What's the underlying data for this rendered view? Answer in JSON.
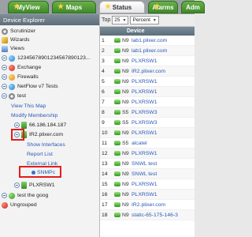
{
  "tabs": [
    {
      "label": "MyView"
    },
    {
      "label": "Maps"
    },
    {
      "label": "Status"
    },
    {
      "label": "Alarms"
    },
    {
      "label": "Adm"
    }
  ],
  "explorer": {
    "title": "Device Explorer",
    "scrutinizer": "Scrutinizer",
    "wizards": "Wizards",
    "views": "Views",
    "group_numeric": "12345678901234567890123...",
    "exchange": "Exchange",
    "firewalls": "Firewalls",
    "netflow": "NetFlow v7 Tests",
    "test": "test",
    "view_this_map": "View This Map",
    "modify_membership": "Modify Membership",
    "ip_device": "66.186.184.187",
    "ir2": "IR2.plixer.com",
    "show_interfaces": "Show Interfaces",
    "report_list": "Report List",
    "external_link": "External Link",
    "snmpc": "SNMPc",
    "plxrsw1": "PLXRSW1",
    "test_goog": "test the goog",
    "ungrouped": "Ungrouped"
  },
  "grid": {
    "top_label": "Top",
    "top_value": "25",
    "sort_value": "Percent",
    "col_device": "Device",
    "rows": [
      {
        "num": "1",
        "type": "N9",
        "device": "lab1.plixer.com"
      },
      {
        "num": "2",
        "type": "N9",
        "device": "lab1.plixer.com"
      },
      {
        "num": "3",
        "type": "N9",
        "device": "PLXRSW1"
      },
      {
        "num": "4",
        "type": "N9",
        "device": "IR2.plixer.com"
      },
      {
        "num": "5",
        "type": "N9",
        "device": "PLXRSW1"
      },
      {
        "num": "6",
        "type": "N9",
        "device": "PLXRSW1"
      },
      {
        "num": "7",
        "type": "N9",
        "device": "PLXRSW1"
      },
      {
        "num": "8",
        "type": "S5",
        "device": "PLXRSW3"
      },
      {
        "num": "9",
        "type": "S5",
        "device": "PLXRSW3"
      },
      {
        "num": "10",
        "type": "N9",
        "device": "PLXRSW1"
      },
      {
        "num": "11",
        "type": "S5",
        "device": "alcatel"
      },
      {
        "num": "12",
        "type": "N9",
        "device": "PLXRSW1"
      },
      {
        "num": "13",
        "type": "N9",
        "device": "SNWL test"
      },
      {
        "num": "14",
        "type": "N9",
        "device": "SNWL test"
      },
      {
        "num": "15",
        "type": "N9",
        "device": "PLXRSW1"
      },
      {
        "num": "16",
        "type": "N9",
        "device": "PLXRSW1"
      },
      {
        "num": "17",
        "type": "N9",
        "device": "IR2.plixer.com"
      },
      {
        "num": "18",
        "type": "N9",
        "device": "static-65-175-146-3"
      }
    ]
  }
}
